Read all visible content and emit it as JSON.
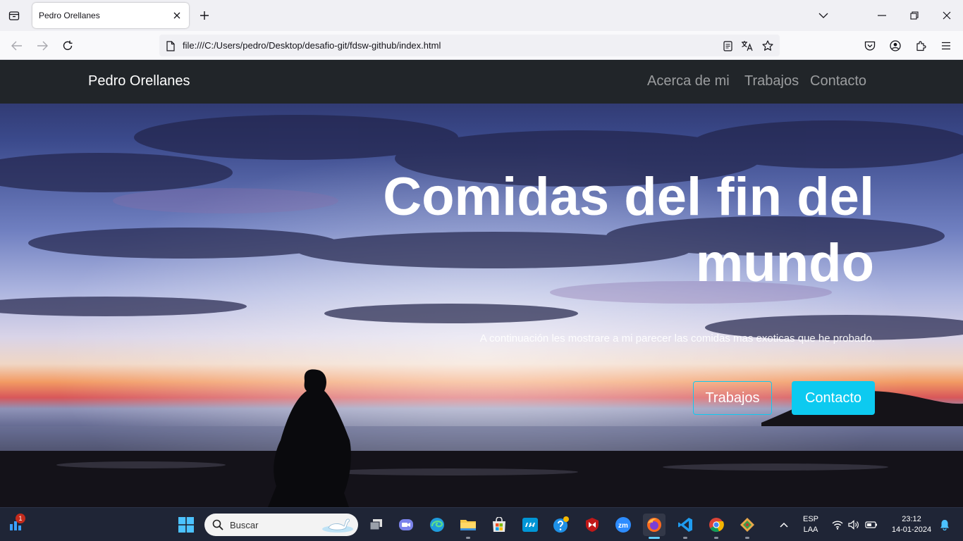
{
  "browser": {
    "tab_title": "Pedro Orellanes",
    "url": "file:///C:/Users/pedro/Desktop/desafio-git/fdsw-github/index.html"
  },
  "site": {
    "brand": "Pedro Orellanes",
    "nav": [
      "Acerca de mi",
      "Trabajos",
      "Contacto"
    ],
    "hero_title": "Comidas del fin del mundo",
    "hero_subtitle": "A continuación les mostrare a mi parecer las comidas mas exoticas que he probado.",
    "btn_works": "Trabajos",
    "btn_contact": "Contacto",
    "accent_color": "#0dcaf0",
    "navbar_color": "#212529"
  },
  "taskbar": {
    "search_placeholder": "Buscar",
    "widgets_badge": "1",
    "lang_line1": "ESP",
    "lang_line2": "LAA",
    "time": "23:12",
    "date": "14-01-2024"
  }
}
